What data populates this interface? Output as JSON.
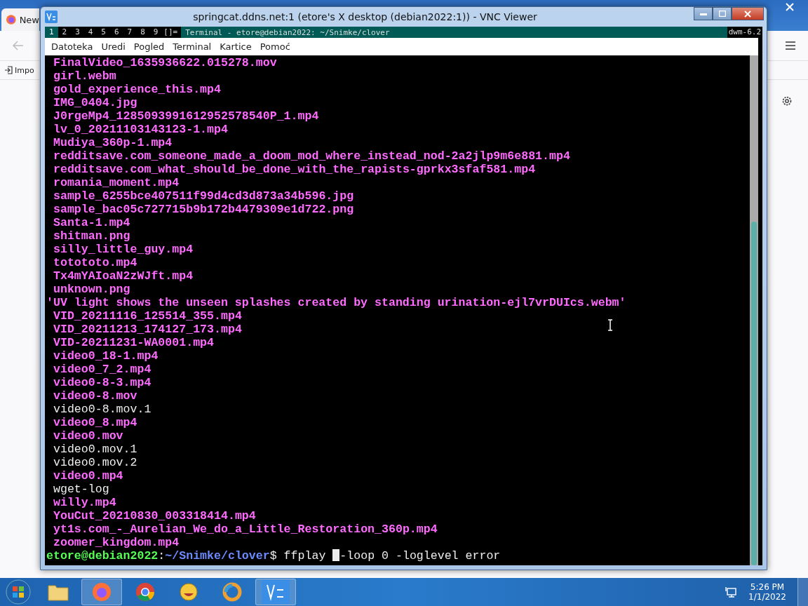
{
  "browser": {
    "tab": {
      "title": "New"
    },
    "bookmark": {
      "label": "Impo"
    }
  },
  "vnc_window": {
    "title": "springcat.ddns.net:1 (etore's X desktop (debian2022:1)) - VNC Viewer"
  },
  "dwm_bar": {
    "tags": [
      {
        "label": "1",
        "selected": true
      },
      {
        "label": "2",
        "selected": false
      },
      {
        "label": "3",
        "selected": false
      },
      {
        "label": "4",
        "selected": false
      },
      {
        "label": "5",
        "selected": false
      },
      {
        "label": "6",
        "selected": false
      },
      {
        "label": "7",
        "selected": false
      },
      {
        "label": "8",
        "selected": false
      },
      {
        "label": "9",
        "selected": false
      }
    ],
    "layout": "[]=",
    "title": "Terminal - etore@debian2022: ~/Snimke/clover",
    "status": "dwm-6.2"
  },
  "menu": [
    "Datoteka",
    "Uredi",
    "Pogled",
    "Terminal",
    "Kartice",
    "Pomoć"
  ],
  "terminal": {
    "lines": [
      {
        "text": "FinalVideo_1635936622.015278.mov",
        "kind": "media"
      },
      {
        "text": "girl.webm",
        "kind": "media"
      },
      {
        "text": "gold_experience_this.mp4",
        "kind": "media"
      },
      {
        "text": "IMG_0404.jpg",
        "kind": "media"
      },
      {
        "text": "J0rgeMp4_1285093991612952578540P_1.mp4",
        "kind": "media"
      },
      {
        "text": "lv_0_20211103143123-1.mp4",
        "kind": "media"
      },
      {
        "text": "Mudiya_360p-1.mp4",
        "kind": "media"
      },
      {
        "text": "redditsave.com_someone_made_a_doom_mod_where_instead_nod-2a2jlp9m6e881.mp4",
        "kind": "media"
      },
      {
        "text": "redditsave.com_what_should_be_done_with_the_rapists-gprkx3sfaf581.mp4",
        "kind": "media"
      },
      {
        "text": "romania_moment.mp4",
        "kind": "media"
      },
      {
        "text": "sample_6255bce407511f99d4cd3d873a34b596.jpg",
        "kind": "media"
      },
      {
        "text": "sample_bac05c727715b9b172b4479309e1d722.png",
        "kind": "media"
      },
      {
        "text": "Santa-1.mp4",
        "kind": "media"
      },
      {
        "text": "shitman.png",
        "kind": "media"
      },
      {
        "text": "silly_little_guy.mp4",
        "kind": "media"
      },
      {
        "text": "totototo.mp4",
        "kind": "media"
      },
      {
        "text": "Tx4mYAIoaN2zWJft.mp4",
        "kind": "media"
      },
      {
        "text": "unknown.png",
        "kind": "media"
      },
      {
        "text": "'UV light shows the unseen splashes created by standing urination-ejl7vrDUIcs.webm'",
        "kind": "media"
      },
      {
        "text": "VID_20211116_125514_355.mp4",
        "kind": "media"
      },
      {
        "text": "VID_20211213_174127_173.mp4",
        "kind": "media"
      },
      {
        "text": "VID-20211231-WA0001.mp4",
        "kind": "media"
      },
      {
        "text": "video0_18-1.mp4",
        "kind": "media"
      },
      {
        "text": "video0_7_2.mp4",
        "kind": "media"
      },
      {
        "text": "video0-8-3.mp4",
        "kind": "media"
      },
      {
        "text": "video0-8.mov",
        "kind": "media"
      },
      {
        "text": "video0-8.mov.1",
        "kind": "plain"
      },
      {
        "text": "video0_8.mp4",
        "kind": "media"
      },
      {
        "text": "video0.mov",
        "kind": "media"
      },
      {
        "text": "video0.mov.1",
        "kind": "plain"
      },
      {
        "text": "video0.mov.2",
        "kind": "plain"
      },
      {
        "text": "video0.mp4",
        "kind": "media"
      },
      {
        "text": "wget-log",
        "kind": "plain"
      },
      {
        "text": "willy.mp4",
        "kind": "media"
      },
      {
        "text": "YouCut_20210830_003318414.mp4",
        "kind": "media"
      },
      {
        "text": "yt1s.com_-_Aurelian_We_do_a_Little_Restoration_360p.mp4",
        "kind": "media"
      },
      {
        "text": "zoomer_kingdom.mp4",
        "kind": "media"
      }
    ],
    "prompt": {
      "user_host": "etore@debian2022",
      "separator": ":",
      "path": "~/Snimke/clover",
      "command": "$ ffplay ",
      "after_cursor": "-loop 0 -loglevel error"
    }
  },
  "taskbar": {
    "clock": {
      "time": "5:26 PM",
      "date": "1/1/2022"
    }
  }
}
